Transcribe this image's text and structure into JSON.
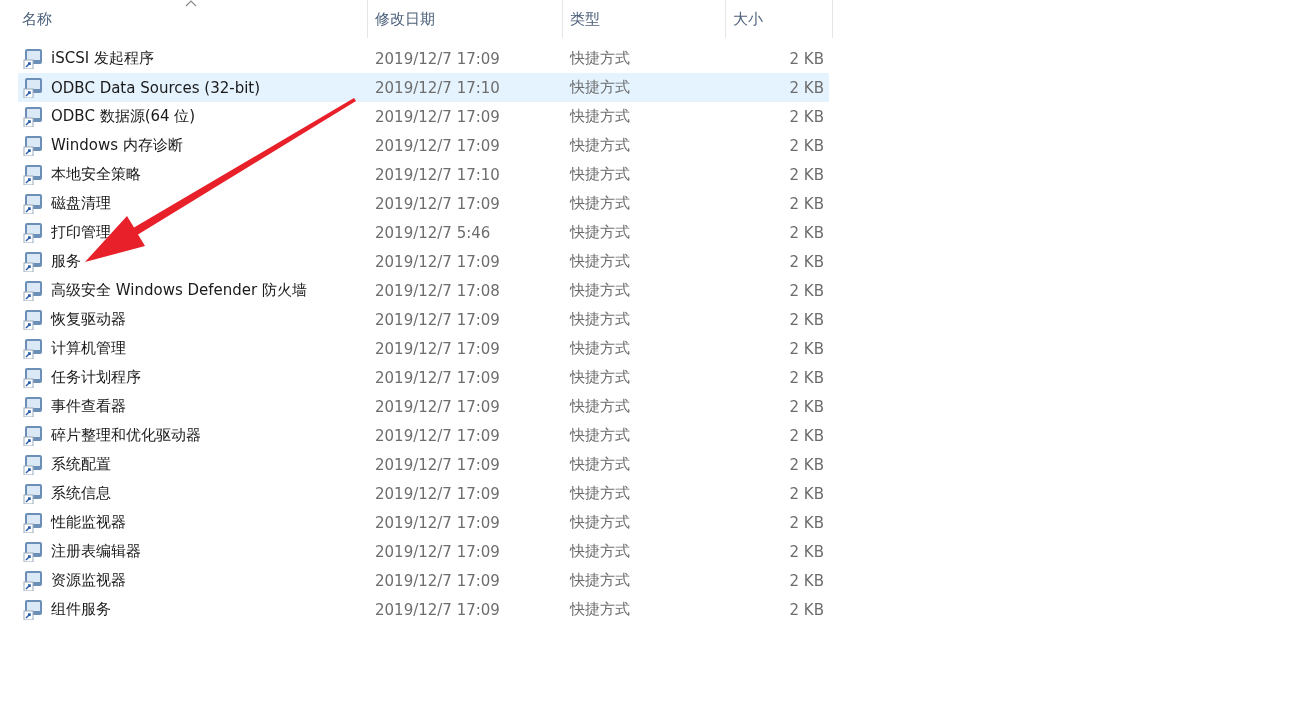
{
  "columns": [
    {
      "label": "名称",
      "sorted": true
    },
    {
      "label": "修改日期",
      "sorted": false
    },
    {
      "label": "类型",
      "sorted": false
    },
    {
      "label": "大小",
      "sorted": false
    }
  ],
  "rows": [
    {
      "name": "iSCSI 发起程序",
      "date": "2019/12/7 17:09",
      "type": "快捷方式",
      "size": "2 KB",
      "selected": false
    },
    {
      "name": "ODBC Data Sources (32-bit)",
      "date": "2019/12/7 17:10",
      "type": "快捷方式",
      "size": "2 KB",
      "selected": true
    },
    {
      "name": "ODBC 数据源(64 位)",
      "date": "2019/12/7 17:09",
      "type": "快捷方式",
      "size": "2 KB",
      "selected": false
    },
    {
      "name": "Windows 内存诊断",
      "date": "2019/12/7 17:09",
      "type": "快捷方式",
      "size": "2 KB",
      "selected": false
    },
    {
      "name": "本地安全策略",
      "date": "2019/12/7 17:10",
      "type": "快捷方式",
      "size": "2 KB",
      "selected": false
    },
    {
      "name": "磁盘清理",
      "date": "2019/12/7 17:09",
      "type": "快捷方式",
      "size": "2 KB",
      "selected": false
    },
    {
      "name": "打印管理",
      "date": "2019/12/7 5:46",
      "type": "快捷方式",
      "size": "2 KB",
      "selected": false
    },
    {
      "name": "服务",
      "date": "2019/12/7 17:09",
      "type": "快捷方式",
      "size": "2 KB",
      "selected": false
    },
    {
      "name": "高级安全 Windows Defender 防火墙",
      "date": "2019/12/7 17:08",
      "type": "快捷方式",
      "size": "2 KB",
      "selected": false
    },
    {
      "name": "恢复驱动器",
      "date": "2019/12/7 17:09",
      "type": "快捷方式",
      "size": "2 KB",
      "selected": false
    },
    {
      "name": "计算机管理",
      "date": "2019/12/7 17:09",
      "type": "快捷方式",
      "size": "2 KB",
      "selected": false
    },
    {
      "name": "任务计划程序",
      "date": "2019/12/7 17:09",
      "type": "快捷方式",
      "size": "2 KB",
      "selected": false
    },
    {
      "name": "事件查看器",
      "date": "2019/12/7 17:09",
      "type": "快捷方式",
      "size": "2 KB",
      "selected": false
    },
    {
      "name": "碎片整理和优化驱动器",
      "date": "2019/12/7 17:09",
      "type": "快捷方式",
      "size": "2 KB",
      "selected": false
    },
    {
      "name": "系统配置",
      "date": "2019/12/7 17:09",
      "type": "快捷方式",
      "size": "2 KB",
      "selected": false
    },
    {
      "name": "系统信息",
      "date": "2019/12/7 17:09",
      "type": "快捷方式",
      "size": "2 KB",
      "selected": false
    },
    {
      "name": "性能监视器",
      "date": "2019/12/7 17:09",
      "type": "快捷方式",
      "size": "2 KB",
      "selected": false
    },
    {
      "name": "注册表编辑器",
      "date": "2019/12/7 17:09",
      "type": "快捷方式",
      "size": "2 KB",
      "selected": false
    },
    {
      "name": "资源监视器",
      "date": "2019/12/7 17:09",
      "type": "快捷方式",
      "size": "2 KB",
      "selected": false
    },
    {
      "name": "组件服务",
      "date": "2019/12/7 17:09",
      "type": "快捷方式",
      "size": "2 KB",
      "selected": false
    }
  ]
}
